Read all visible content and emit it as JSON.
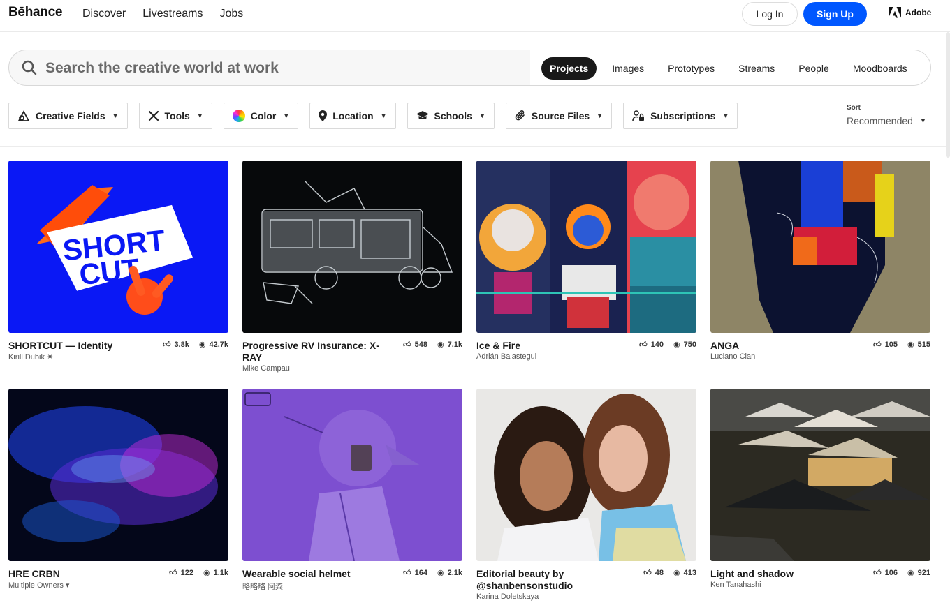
{
  "header": {
    "logo": "Bēhance",
    "nav": [
      "Discover",
      "Livestreams",
      "Jobs"
    ],
    "login": "Log In",
    "signup": "Sign Up",
    "adobe": "Adobe"
  },
  "search": {
    "placeholder": "Search the creative world at work",
    "tabs": [
      "Projects",
      "Images",
      "Prototypes",
      "Streams",
      "People",
      "Moodboards"
    ],
    "active_tab": "Projects"
  },
  "filters": [
    "Creative Fields",
    "Tools",
    "Color",
    "Location",
    "Schools",
    "Source Files",
    "Subscriptions"
  ],
  "sort": {
    "label": "Sort",
    "value": "Recommended"
  },
  "projects": [
    {
      "title": "SHORTCUT — Identity",
      "owner": "Kirill Dubik ✷",
      "likes": "3.8k",
      "views": "42.7k"
    },
    {
      "title": "Progressive RV Insurance: X-RAY",
      "owner": "Mike Campau",
      "likes": "548",
      "views": "7.1k"
    },
    {
      "title": "Ice & Fire",
      "owner": "Adrián Balastegui",
      "likes": "140",
      "views": "750"
    },
    {
      "title": "ANGA",
      "owner": "Luciano Cian",
      "likes": "105",
      "views": "515"
    },
    {
      "title": "HRE CRBN",
      "owner": "Multiple Owners ▾",
      "likes": "122",
      "views": "1.1k"
    },
    {
      "title": "Wearable social helmet",
      "owner": "略略略 阿粢",
      "likes": "164",
      "views": "2.1k"
    },
    {
      "title": "Editorial beauty by @shanbensonstudio",
      "owner": "Karina Doletskaya",
      "likes": "48",
      "views": "413"
    },
    {
      "title": "Light and shadow",
      "owner": "Ken Tanahashi",
      "likes": "106",
      "views": "921"
    }
  ],
  "thumb_art": {
    "shortcut_text_1": "SHORT",
    "shortcut_text_2": "CUT"
  },
  "colors": {
    "brand_blue": "#0057ff",
    "active_tab": "#191919"
  }
}
